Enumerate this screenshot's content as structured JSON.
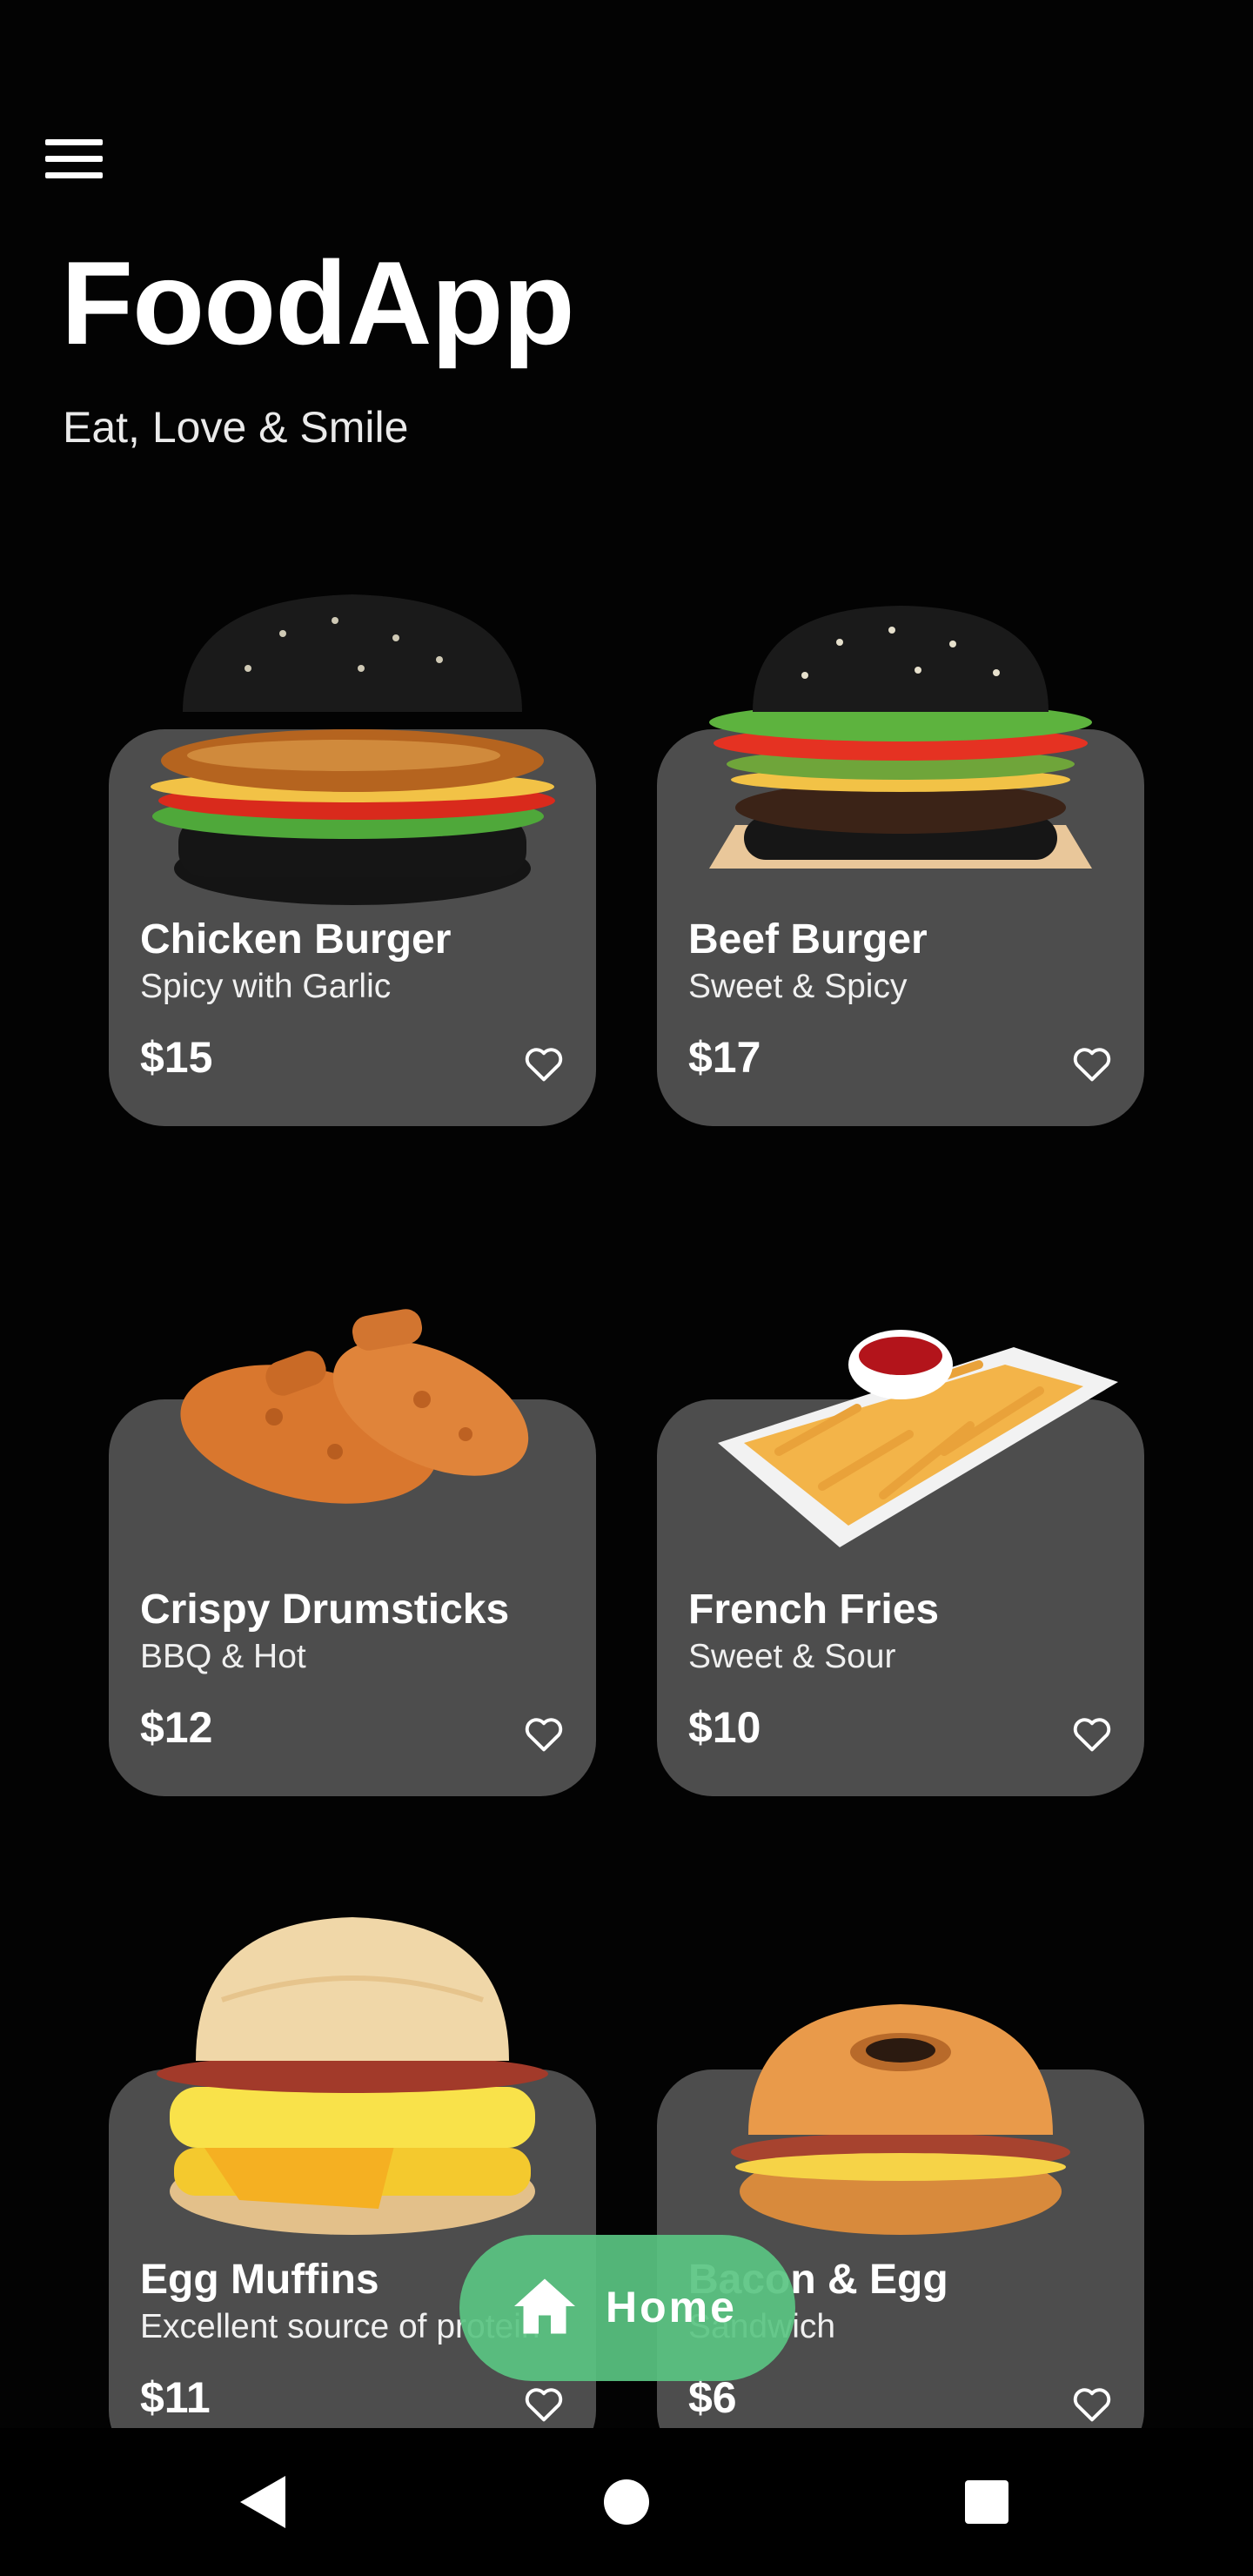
{
  "app": {
    "title": "FoodApp",
    "tagline": "Eat, Love & Smile"
  },
  "header": {
    "menu_icon": "hamburger-menu-icon"
  },
  "items": [
    {
      "name": "Chicken Burger",
      "description": "Spicy with Garlic",
      "price": "$15",
      "image": "chicken-burger-image",
      "favorite": false
    },
    {
      "name": "Beef Burger",
      "description": "Sweet & Spicy",
      "price": "$17",
      "image": "beef-burger-image",
      "favorite": false
    },
    {
      "name": "Crispy Drumsticks",
      "description": "BBQ & Hot",
      "price": "$12",
      "image": "drumsticks-image",
      "favorite": false
    },
    {
      "name": "French Fries",
      "description": "Sweet & Sour",
      "price": "$10",
      "image": "french-fries-image",
      "favorite": false
    },
    {
      "name": "Egg Muffins",
      "description": "Excellent source of protein",
      "price": "$11",
      "image": "egg-muffin-image",
      "favorite": false
    },
    {
      "name": "Bacon & Egg",
      "description": "Sandwich",
      "price": "$6",
      "image": "bacon-egg-bagel-image",
      "favorite": false
    }
  ],
  "bottom_nav": {
    "active_label": "Home",
    "active_icon": "home-icon"
  },
  "system_nav": {
    "back_icon": "back-triangle-icon",
    "home_icon": "home-circle-icon",
    "recents_icon": "recents-square-icon"
  },
  "colors": {
    "background": "#030303",
    "card": "#4d4d4d",
    "accent": "#5ac482",
    "text": "#ffffff"
  }
}
